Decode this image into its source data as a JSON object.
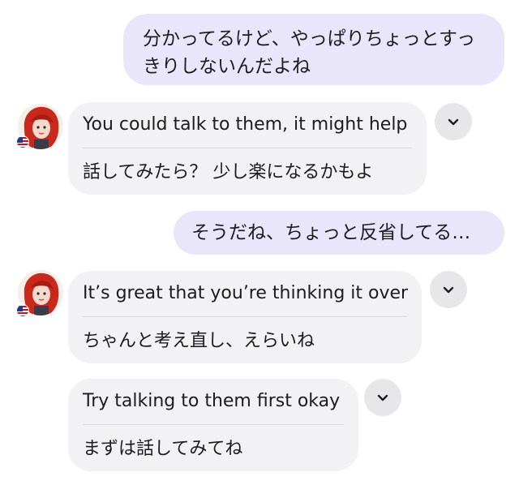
{
  "messages": {
    "user_1": "分かってるけど、やっぱりちょっとすっきりしないんだよね",
    "ai_1": {
      "english": "You could talk to them, it might help",
      "japanese": "話してみたら？ 少し楽になるかもよ"
    },
    "user_2": "そうだね、ちょっと反省してる…",
    "ai_2": {
      "english": "It’s great that you’re thinking it over",
      "japanese": "ちゃんと考え直し、えらいね"
    },
    "ai_3": {
      "english": "Try talking to them first okay",
      "japanese": "まずは話してみてね"
    }
  },
  "icons": {
    "expand": "chevron-down-icon",
    "avatar": "avatar",
    "language_flag": "us-flag-icon"
  },
  "colors": {
    "user_bubble": "#e9e6fb",
    "ai_bubble": "#f2f2f4",
    "chevron_bg": "#e7e7ea",
    "hair": "#c9281c"
  }
}
